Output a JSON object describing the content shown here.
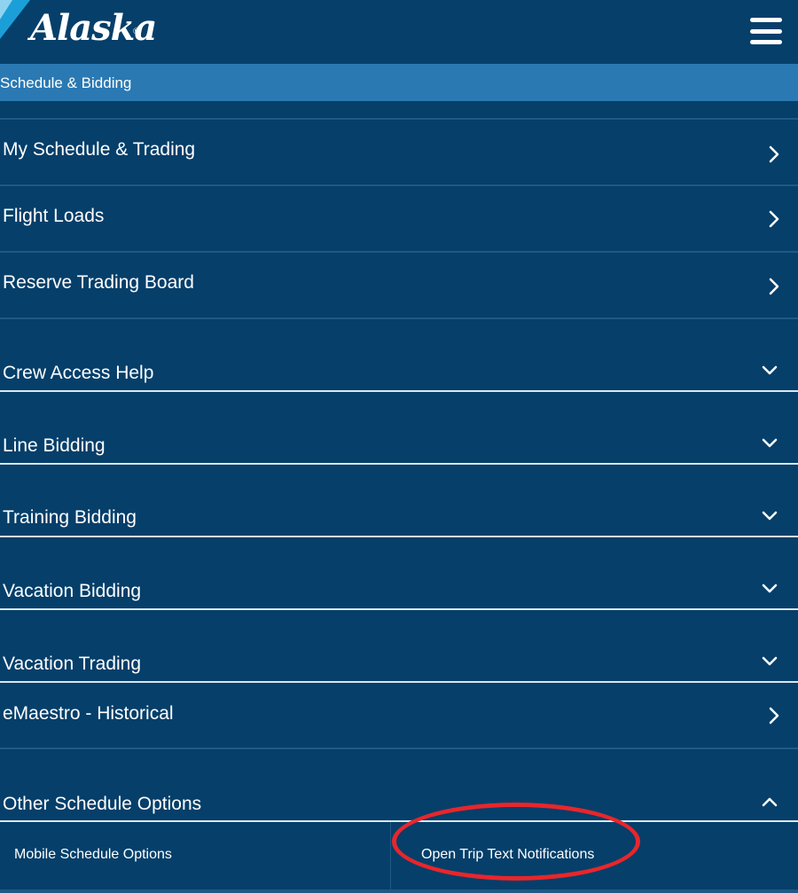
{
  "header": {
    "logo_text": "Alaska",
    "logo_mark": "®",
    "menu_icon": "hamburger-menu-icon"
  },
  "breadcrumb": {
    "label": "Schedule & Bidding"
  },
  "menu": {
    "items": [
      {
        "label": "My Schedule & Trading",
        "icon": "chevron-right-icon"
      },
      {
        "label": "Flight Loads",
        "icon": "chevron-right-icon"
      },
      {
        "label": "Reserve Trading Board",
        "icon": "chevron-right-icon"
      },
      {
        "label": "Crew Access Help",
        "icon": "chevron-down-icon"
      },
      {
        "label": "Line Bidding",
        "icon": "chevron-down-icon"
      },
      {
        "label": "Training Bidding",
        "icon": "chevron-down-icon"
      },
      {
        "label": "Vacation Bidding",
        "icon": "chevron-down-icon"
      },
      {
        "label": "Vacation Trading",
        "icon": "chevron-down-icon"
      },
      {
        "label": "eMaestro - Historical",
        "icon": "chevron-right-icon"
      },
      {
        "label": "Other Schedule Options",
        "icon": "chevron-up-icon"
      }
    ],
    "submenu": [
      {
        "label": "Mobile Schedule Options"
      },
      {
        "label": "Open Trip Text Notifications"
      }
    ]
  },
  "colors": {
    "background": "#053f6a",
    "breadcrumb_bar": "#2a79b3",
    "highlight_circle": "#e8262b"
  }
}
